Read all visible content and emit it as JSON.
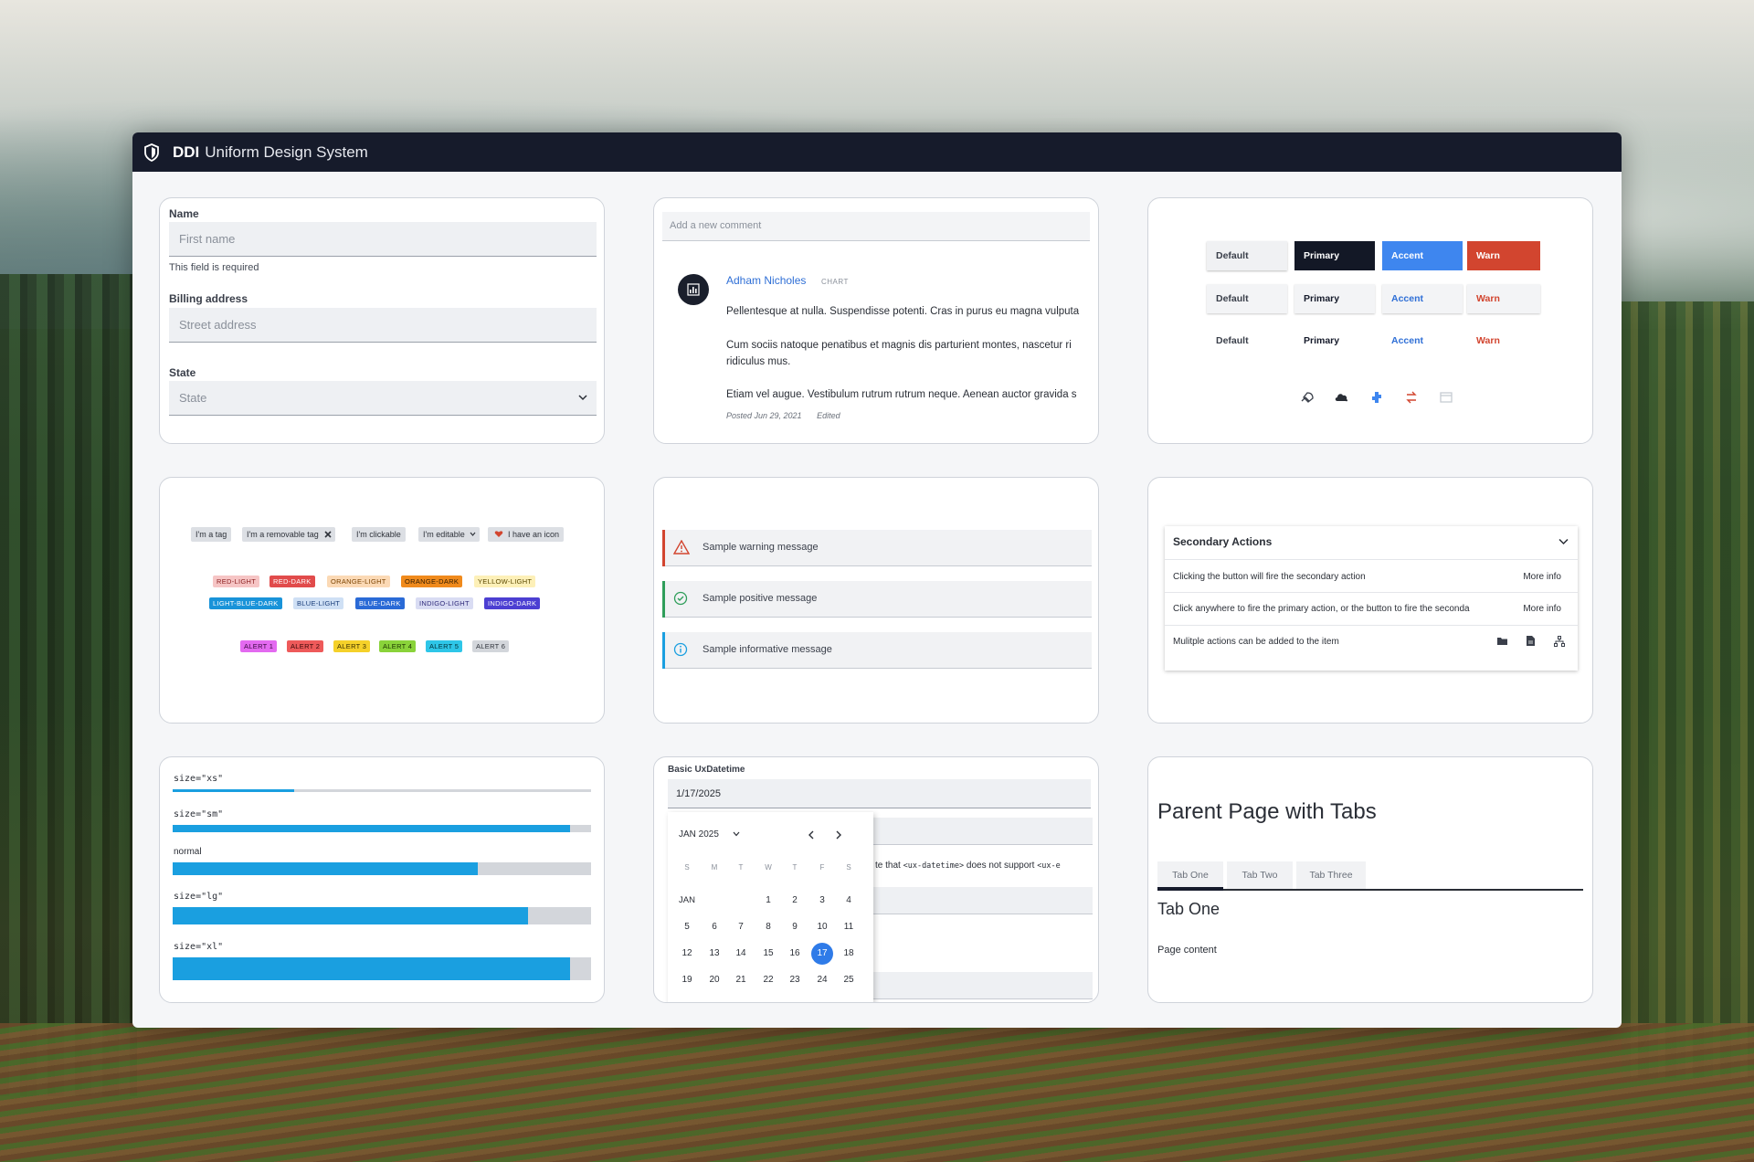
{
  "window": {
    "brand": "DDI",
    "title": "Uniform Design System"
  },
  "form": {
    "name_label": "Name",
    "name_placeholder": "First name",
    "name_hint": "This field is required",
    "billing_label": "Billing address",
    "billing_placeholder": "Street address",
    "state_label": "State",
    "state_value": "State"
  },
  "comment": {
    "placeholder": "Add a new comment",
    "author": "Adham Nicholes",
    "tag": "CHART",
    "paragraphs": [
      "Pellentesque at nulla. Suspendisse potenti. Cras in purus eu magna vulputa",
      "Cum sociis natoque penatibus et magnis dis parturient montes, nascetur ri",
      "ridiculus mus.",
      "Etiam vel augue. Vestibulum rutrum rutrum neque. Aenean auctor gravida s"
    ],
    "posted": "Posted Jun 29, 2021",
    "edited": "Edited"
  },
  "buttons": {
    "row1": [
      "Default",
      "Primary",
      "Accent",
      "Warn"
    ],
    "row2": [
      "Default",
      "Primary",
      "Accent",
      "Warn"
    ],
    "row3": [
      "Default",
      "Primary",
      "Accent",
      "Warn"
    ],
    "icons": [
      "rocket-icon",
      "cloud-icon",
      "puzzle-icon",
      "arrows-icon",
      "window-icon"
    ]
  },
  "tags": {
    "basic": [
      "I'm a tag",
      "I'm a removable tag",
      "I'm clickable",
      "I'm editable",
      "I have an icon"
    ],
    "colors_row1": [
      "RED-LIGHT",
      "RED-DARK",
      "ORANGE-LIGHT",
      "ORANGE-DARK",
      "YELLOW-LIGHT"
    ],
    "colors_row2": [
      "LIGHT-BLUE-DARK",
      "BLUE-LIGHT",
      "BLUE-DARK",
      "INDIGO-LIGHT",
      "INDIGO-DARK"
    ],
    "alerts": [
      "ALERT 1",
      "ALERT 2",
      "ALERT 3",
      "ALERT 4",
      "ALERT 5",
      "ALERT 6"
    ],
    "colors": {
      "red_light": "#f6c5c5",
      "red_dark": "#e14b4b",
      "orange_light": "#fbd9b5",
      "orange_dark": "#f08a1c",
      "yellow_light": "#fdf0b8",
      "light_blue_dark": "#1993d9",
      "blue_light": "#cfe0f5",
      "blue_dark": "#2a6ad6",
      "indigo_light": "#d9dcf3",
      "indigo_dark": "#4c3fd2"
    }
  },
  "alerts": {
    "warning": "Sample warning message",
    "positive": "Sample positive message",
    "info": "Sample informative message",
    "warning_color": "#d2452f",
    "positive_color": "#2f9e5a",
    "info_color": "#1a9fe0"
  },
  "secondary": {
    "title": "Secondary Actions",
    "rows": [
      {
        "text": "Clicking the button will fire the secondary action",
        "action": "More info"
      },
      {
        "text": "Click anywhere to fire the primary action, or the button to fire the seconda",
        "action": "More info"
      },
      {
        "text": "Mulitple actions can be added to the item"
      }
    ]
  },
  "progress": {
    "xs_label": "size=\"xs\"",
    "sm_label": "size=\"sm\"",
    "normal_label": "normal",
    "lg_label": "size=\"lg\"",
    "xl_label": "size=\"xl\"",
    "xs_value": 0.29,
    "sm_value": 0.95,
    "normal_value": 0.73,
    "lg_value": 0.85,
    "xl_value": 0.95
  },
  "datetime": {
    "label": "Basic UxDatetime",
    "value": "1/17/2025",
    "note_pre": "te that",
    "note_code1": "<ux-datetime>",
    "note_mid": "does not support",
    "note_code2": "<ux-e",
    "month_select": "JAN 2025",
    "month_short": "JAN",
    "dow": [
      "S",
      "M",
      "T",
      "W",
      "T",
      "F",
      "S"
    ],
    "days": [
      "1",
      "2",
      "3",
      "4",
      "5",
      "6",
      "7",
      "8",
      "9",
      "10",
      "11",
      "12",
      "13",
      "14",
      "15",
      "16",
      "17",
      "18",
      "19",
      "20",
      "21",
      "22",
      "23",
      "24",
      "25"
    ],
    "selected": "17"
  },
  "tabs": {
    "page_title": "Parent Page with Tabs",
    "items": [
      "Tab One",
      "Tab Two",
      "Tab Three"
    ],
    "active_heading": "Tab One",
    "content": "Page content"
  }
}
